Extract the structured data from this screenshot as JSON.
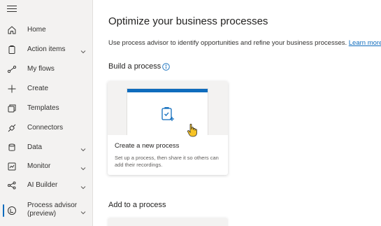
{
  "sidebar": {
    "items": [
      {
        "label": "Home",
        "icon": "home-icon",
        "has_chevron": false
      },
      {
        "label": "Action items",
        "icon": "clipboard-icon",
        "has_chevron": true
      },
      {
        "label": "My flows",
        "icon": "flow-icon",
        "has_chevron": false
      },
      {
        "label": "Create",
        "icon": "plus-icon",
        "has_chevron": false
      },
      {
        "label": "Templates",
        "icon": "templates-icon",
        "has_chevron": false
      },
      {
        "label": "Connectors",
        "icon": "connector-icon",
        "has_chevron": false
      },
      {
        "label": "Data",
        "icon": "database-icon",
        "has_chevron": true
      },
      {
        "label": "Monitor",
        "icon": "monitor-icon",
        "has_chevron": true
      },
      {
        "label": "AI Builder",
        "icon": "ai-builder-icon",
        "has_chevron": true
      },
      {
        "label": "Process advisor\n(preview)",
        "label_line1": "Process advisor",
        "label_line2": "(preview)",
        "icon": "process-advisor-icon",
        "has_chevron": true,
        "active": true
      }
    ],
    "accent_color": "#0f6cbd"
  },
  "main": {
    "title": "Optimize your business processes",
    "subtitle": "Use process advisor to identify opportunities and refine your business processes.",
    "learn_more": "Learn more",
    "build_section": "Build a process",
    "card": {
      "title": "Create a new process",
      "description": "Set up a process, then share it so others can add their recordings."
    },
    "add_section": "Add to a process"
  }
}
